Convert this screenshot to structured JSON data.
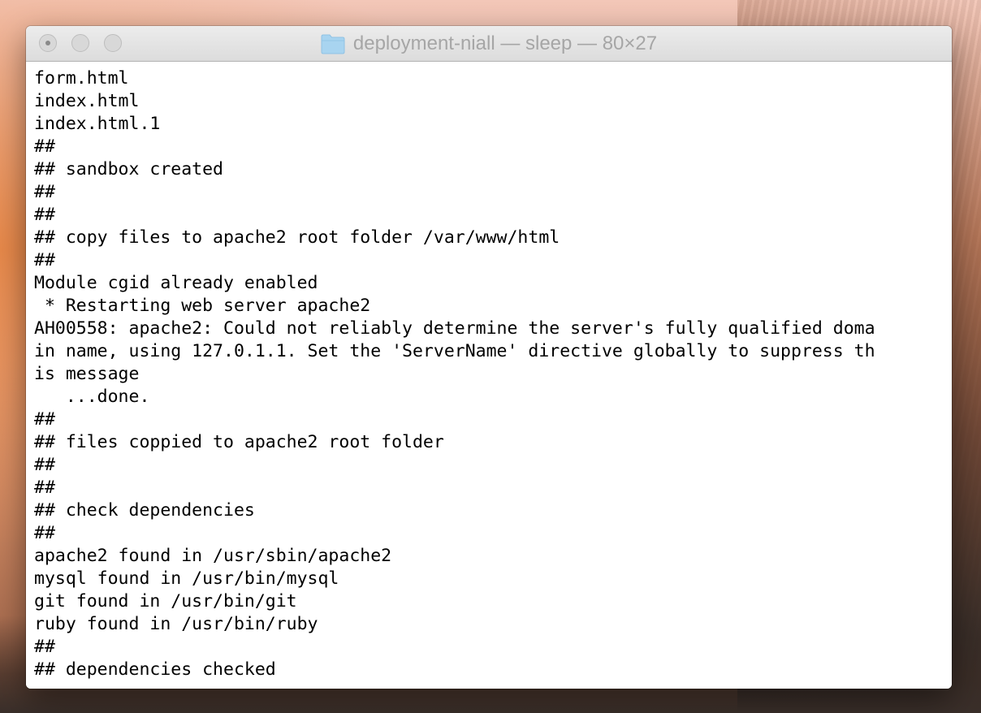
{
  "window": {
    "title": "deployment-niall — sleep — 80×27"
  },
  "terminal": {
    "lines": [
      "form.html",
      "index.html",
      "index.html.1",
      "##",
      "## sandbox created",
      "##",
      "##",
      "## copy files to apache2 root folder /var/www/html",
      "##",
      "Module cgid already enabled",
      " * Restarting web server apache2",
      "AH00558: apache2: Could not reliably determine the server's fully qualified doma",
      "in name, using 127.0.1.1. Set the 'ServerName' directive globally to suppress th",
      "is message",
      "   ...done.",
      "##",
      "## files coppied to apache2 root folder",
      "##",
      "##",
      "## check dependencies",
      "##",
      "apache2 found in /usr/sbin/apache2",
      "mysql found in /usr/bin/mysql",
      "git found in /usr/bin/git",
      "ruby found in /usr/bin/ruby",
      "##",
      "## dependencies checked"
    ]
  },
  "colors": {
    "terminal_background": "#ffffff",
    "terminal_text": "#000000",
    "title_text": "#a6a6a6",
    "folder_icon": "#a8d4f0"
  },
  "icons": {
    "close": "close-icon",
    "minimize": "minimize-icon",
    "zoom": "zoom-icon",
    "title": "folder-icon"
  }
}
